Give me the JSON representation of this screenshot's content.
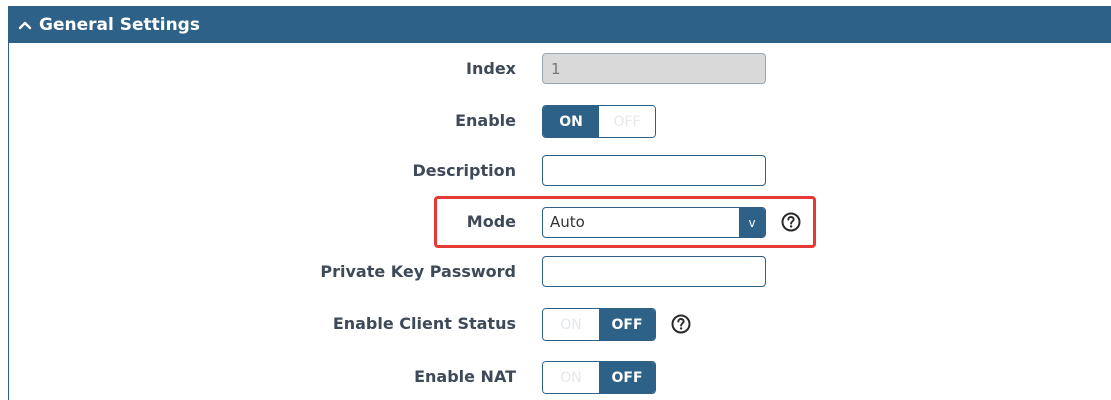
{
  "panel": {
    "title": "General Settings"
  },
  "fields": {
    "index": {
      "label": "Index",
      "value": "1"
    },
    "enable": {
      "label": "Enable",
      "on": "ON",
      "off": "OFF",
      "state": "on"
    },
    "description": {
      "label": "Description",
      "value": ""
    },
    "mode": {
      "label": "Mode",
      "value": "Auto",
      "arrow": "v"
    },
    "private_key_password": {
      "label": "Private Key Password",
      "value": ""
    },
    "enable_client_status": {
      "label": "Enable Client Status",
      "on": "ON",
      "off": "OFF",
      "state": "off"
    },
    "enable_nat": {
      "label": "Enable NAT",
      "on": "ON",
      "off": "OFF",
      "state": "off"
    }
  },
  "icons": {
    "header": "chevron-up-icon",
    "help": "question-circle-icon"
  },
  "colors": {
    "header_bg": "#2d6188",
    "accent": "#2d6188",
    "highlight": "#e53935"
  }
}
